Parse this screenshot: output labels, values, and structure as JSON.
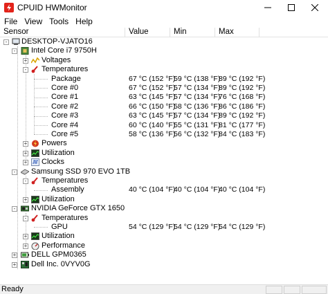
{
  "window": {
    "title": "CPUID HWMonitor"
  },
  "menu": [
    "File",
    "View",
    "Tools",
    "Help"
  ],
  "columns": {
    "sensor": "Sensor",
    "value": "Value",
    "min": "Min",
    "max": "Max"
  },
  "tree": [
    {
      "label": "DESKTOP-VJATO16",
      "icon": "computer-icon",
      "exp": "-"
    },
    {
      "label": "Intel Core i7 9750H",
      "icon": "cpu-chip-icon",
      "exp": "-"
    },
    {
      "label": "Voltages",
      "icon": "voltage-icon",
      "exp": "+"
    },
    {
      "label": "Temperatures",
      "icon": "thermometer-icon",
      "exp": "-"
    },
    {
      "label": "Package",
      "value": "67 °C  (152 °F)",
      "min": "59 °C  (138 °F)",
      "max": "89 °C  (192 °F)"
    },
    {
      "label": "Core #0",
      "value": "67 °C  (152 °F)",
      "min": "57 °C  (134 °F)",
      "max": "89 °C  (192 °F)"
    },
    {
      "label": "Core #1",
      "value": "63 °C  (145 °F)",
      "min": "57 °C  (134 °F)",
      "max": "76 °C  (168 °F)"
    },
    {
      "label": "Core #2",
      "value": "66 °C  (150 °F)",
      "min": "58 °C  (136 °F)",
      "max": "86 °C  (186 °F)"
    },
    {
      "label": "Core #3",
      "value": "63 °C  (145 °F)",
      "min": "57 °C  (134 °F)",
      "max": "89 °C  (192 °F)"
    },
    {
      "label": "Core #4",
      "value": "60 °C  (140 °F)",
      "min": "55 °C  (131 °F)",
      "max": "81 °C  (177 °F)"
    },
    {
      "label": "Core #5",
      "value": "58 °C  (136 °F)",
      "min": "56 °C  (132 °F)",
      "max": "84 °C  (183 °F)"
    },
    {
      "label": "Powers",
      "icon": "power-icon",
      "exp": "+"
    },
    {
      "label": "Utilization",
      "icon": "utilization-icon",
      "exp": "+"
    },
    {
      "label": "Clocks",
      "icon": "clock-icon",
      "exp": "+"
    },
    {
      "label": "Samsung SSD 970 EVO 1TB",
      "icon": "ssd-drive-icon",
      "exp": "-"
    },
    {
      "label": "Temperatures",
      "icon": "thermometer-icon",
      "exp": "-"
    },
    {
      "label": "Assembly",
      "value": "40 °C  (104 °F)",
      "min": "40 °C  (104 °F)",
      "max": "40 °C  (104 °F)"
    },
    {
      "label": "Utilization",
      "icon": "utilization-icon",
      "exp": "+"
    },
    {
      "label": "NVIDIA GeForce GTX 1650",
      "icon": "gpu-card-icon",
      "exp": "-"
    },
    {
      "label": "Temperatures",
      "icon": "thermometer-icon",
      "exp": "-"
    },
    {
      "label": "GPU",
      "value": "54 °C  (129 °F)",
      "min": "54 °C  (129 °F)",
      "max": "54 °C  (129 °F)"
    },
    {
      "label": "Utilization",
      "icon": "utilization-icon",
      "exp": "+"
    },
    {
      "label": "Performance",
      "icon": "performance-gauge-icon",
      "exp": "+"
    },
    {
      "label": "DELL GPM0365",
      "icon": "battery-icon",
      "exp": "+"
    },
    {
      "label": "Dell Inc. 0VYV0G",
      "icon": "motherboard-icon",
      "exp": "+"
    }
  ],
  "status": {
    "text": "Ready"
  },
  "colors": {
    "accent_red": "#e2231a",
    "tree_line": "#b5b5b5",
    "status_bg": "#f0f0f0"
  }
}
